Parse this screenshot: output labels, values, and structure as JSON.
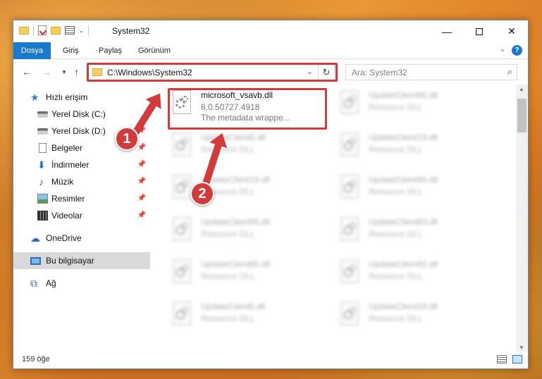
{
  "window": {
    "title": "System32",
    "min_glyph": "—",
    "close_glyph": "✕"
  },
  "ribbon": {
    "tabs": [
      "Dosya",
      "Giriş",
      "Paylaş",
      "Görünüm"
    ],
    "collapse_glyph": "⌄",
    "help_glyph": "?"
  },
  "nav": {
    "back_glyph": "←",
    "forward_glyph": "→",
    "recent_glyph": "▼",
    "up_glyph": "↑"
  },
  "address": {
    "path": "C:\\Windows\\System32",
    "dropdown_glyph": "⌄",
    "refresh_glyph": "↻"
  },
  "search": {
    "placeholder": "Ara: System32",
    "icon_glyph": "⌕"
  },
  "sidebar": {
    "pin_glyph": "📌",
    "items": [
      {
        "label": "Hızlı erişim",
        "icon": "star-icon",
        "glyph": "★"
      },
      {
        "label": "Yerel Disk (C:)",
        "icon": "drive-icon"
      },
      {
        "label": "Yerel Disk (D:)",
        "icon": "drive-icon"
      },
      {
        "label": "Belgeler",
        "icon": "documents-icon"
      },
      {
        "label": "İndirmeler",
        "icon": "download-icon",
        "glyph": "⬇"
      },
      {
        "label": "Müzik",
        "icon": "music-icon",
        "glyph": "♪"
      },
      {
        "label": "Resimler",
        "icon": "pictures-icon"
      },
      {
        "label": "Videolar",
        "icon": "videos-icon"
      },
      {
        "label": "OneDrive",
        "icon": "cloud-icon",
        "glyph": "☁"
      },
      {
        "label": "Bu bilgisayar",
        "icon": "computer-icon"
      },
      {
        "label": "Ağ",
        "icon": "network-icon",
        "glyph": "⧉"
      }
    ]
  },
  "files": [
    {
      "name": "microsoft_vsavb.dll",
      "line2": "8.0.50727.4918",
      "line3": "The metadata wrappe..."
    },
    {
      "name": "UpdateClient65.dll",
      "line2": "Resource DLL"
    },
    {
      "name": "UpdateClient5.dll",
      "line2": "Resource DLL"
    },
    {
      "name": "UpdateClient19.dll",
      "line2": "Resource DLL"
    },
    {
      "name": "UpdateClient19.dll",
      "line2": "Resource DLL"
    },
    {
      "name": "UpdateClient65.dll",
      "line2": "Resource DLL"
    },
    {
      "name": "UpdateClient65.dll",
      "line2": "Resource DLL"
    },
    {
      "name": "UpdateClient63.dll",
      "line2": "Resource DLL"
    },
    {
      "name": "UpdateClient65.dll",
      "line2": "Resource DLL"
    },
    {
      "name": "UpdateClient42.dll",
      "line2": "Resource DLL"
    },
    {
      "name": "UpdateClient5.dll",
      "line2": "Resource DLL"
    },
    {
      "name": "UpdateClient19.dll",
      "line2": "Resource DLL"
    }
  ],
  "status": {
    "count": "159 öğe"
  },
  "markers": {
    "step1": "1",
    "step2": "2"
  },
  "scroll": {
    "up_glyph": "▲",
    "down_glyph": "▼"
  },
  "colors": {
    "accent": "#1979ca",
    "highlight": "#d33b3b",
    "selected_nav": "#d9d9d9"
  }
}
